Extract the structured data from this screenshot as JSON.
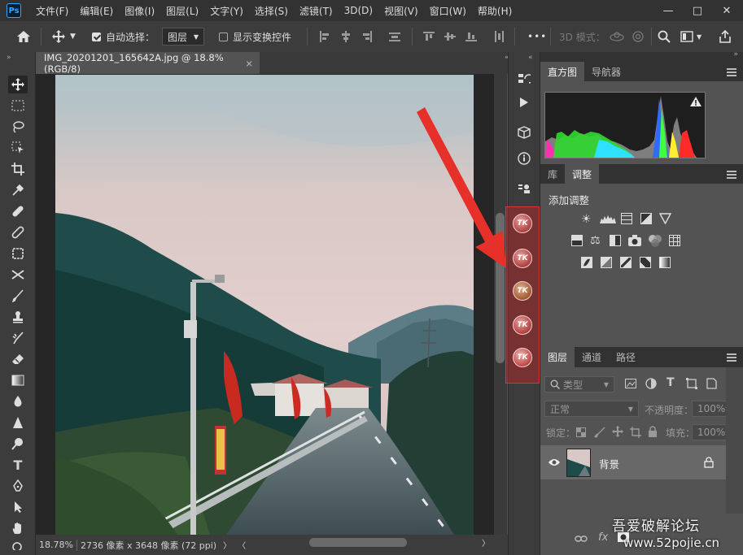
{
  "app": {
    "logo": "Ps"
  },
  "menu": [
    "文件(F)",
    "编辑(E)",
    "图像(I)",
    "图层(L)",
    "文字(Y)",
    "选择(S)",
    "滤镜(T)",
    "3D(D)",
    "视图(V)",
    "窗口(W)",
    "帮助(H)"
  ],
  "window_controls": {
    "minimize": "—",
    "maximize": "□",
    "close": "✕"
  },
  "options_bar": {
    "auto_select_label": "自动选择：",
    "auto_select_checked": true,
    "target_value": "图层",
    "show_transform_label": "显示变换控件",
    "show_transform_checked": false,
    "more": "•••",
    "mode_3d_label": "3D 模式："
  },
  "document": {
    "tab_title": "IMG_20201201_165642A.jpg @ 18.8%(RGB/8)",
    "close": "×"
  },
  "status": {
    "zoom": "18.78%",
    "info": "2736 像素 x 3648 像素 (72 ppi)"
  },
  "panels": {
    "top_tabs": [
      "直方图",
      "导航器"
    ],
    "mid_tabs": [
      "库",
      "调整"
    ],
    "add_adjustment": "添加调整",
    "layers_tabs": [
      "图层",
      "通道",
      "路径"
    ],
    "filter_kind": "类型",
    "blend_mode": "正常",
    "opacity_label": "不透明度：",
    "opacity_value": "100%",
    "lock_label": "锁定：",
    "fill_label": "填充：",
    "fill_value": "100%",
    "layer_name": "背景"
  },
  "plugin_icons": [
    "TK",
    "TK",
    "TK",
    "TK",
    "TK"
  ],
  "watermark": {
    "line1": "吾爱破解论坛",
    "line2": "www.52pojie.cn"
  },
  "colors": {
    "accent_red": "#e8302a",
    "highlight_box": "#c83232"
  }
}
